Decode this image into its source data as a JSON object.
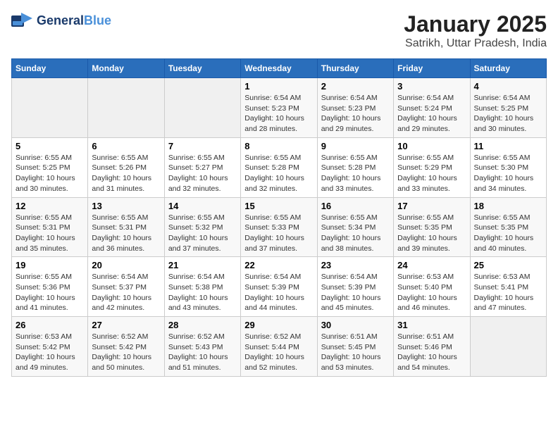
{
  "header": {
    "logo_line1": "General",
    "logo_line2": "Blue",
    "title": "January 2025",
    "subtitle": "Satrikh, Uttar Pradesh, India"
  },
  "weekdays": [
    "Sunday",
    "Monday",
    "Tuesday",
    "Wednesday",
    "Thursday",
    "Friday",
    "Saturday"
  ],
  "weeks": [
    [
      {
        "num": "",
        "info": ""
      },
      {
        "num": "",
        "info": ""
      },
      {
        "num": "",
        "info": ""
      },
      {
        "num": "1",
        "info": "Sunrise: 6:54 AM\nSunset: 5:23 PM\nDaylight: 10 hours\nand 28 minutes."
      },
      {
        "num": "2",
        "info": "Sunrise: 6:54 AM\nSunset: 5:23 PM\nDaylight: 10 hours\nand 29 minutes."
      },
      {
        "num": "3",
        "info": "Sunrise: 6:54 AM\nSunset: 5:24 PM\nDaylight: 10 hours\nand 29 minutes."
      },
      {
        "num": "4",
        "info": "Sunrise: 6:54 AM\nSunset: 5:25 PM\nDaylight: 10 hours\nand 30 minutes."
      }
    ],
    [
      {
        "num": "5",
        "info": "Sunrise: 6:55 AM\nSunset: 5:25 PM\nDaylight: 10 hours\nand 30 minutes."
      },
      {
        "num": "6",
        "info": "Sunrise: 6:55 AM\nSunset: 5:26 PM\nDaylight: 10 hours\nand 31 minutes."
      },
      {
        "num": "7",
        "info": "Sunrise: 6:55 AM\nSunset: 5:27 PM\nDaylight: 10 hours\nand 32 minutes."
      },
      {
        "num": "8",
        "info": "Sunrise: 6:55 AM\nSunset: 5:28 PM\nDaylight: 10 hours\nand 32 minutes."
      },
      {
        "num": "9",
        "info": "Sunrise: 6:55 AM\nSunset: 5:28 PM\nDaylight: 10 hours\nand 33 minutes."
      },
      {
        "num": "10",
        "info": "Sunrise: 6:55 AM\nSunset: 5:29 PM\nDaylight: 10 hours\nand 33 minutes."
      },
      {
        "num": "11",
        "info": "Sunrise: 6:55 AM\nSunset: 5:30 PM\nDaylight: 10 hours\nand 34 minutes."
      }
    ],
    [
      {
        "num": "12",
        "info": "Sunrise: 6:55 AM\nSunset: 5:31 PM\nDaylight: 10 hours\nand 35 minutes."
      },
      {
        "num": "13",
        "info": "Sunrise: 6:55 AM\nSunset: 5:31 PM\nDaylight: 10 hours\nand 36 minutes."
      },
      {
        "num": "14",
        "info": "Sunrise: 6:55 AM\nSunset: 5:32 PM\nDaylight: 10 hours\nand 37 minutes."
      },
      {
        "num": "15",
        "info": "Sunrise: 6:55 AM\nSunset: 5:33 PM\nDaylight: 10 hours\nand 37 minutes."
      },
      {
        "num": "16",
        "info": "Sunrise: 6:55 AM\nSunset: 5:34 PM\nDaylight: 10 hours\nand 38 minutes."
      },
      {
        "num": "17",
        "info": "Sunrise: 6:55 AM\nSunset: 5:35 PM\nDaylight: 10 hours\nand 39 minutes."
      },
      {
        "num": "18",
        "info": "Sunrise: 6:55 AM\nSunset: 5:35 PM\nDaylight: 10 hours\nand 40 minutes."
      }
    ],
    [
      {
        "num": "19",
        "info": "Sunrise: 6:55 AM\nSunset: 5:36 PM\nDaylight: 10 hours\nand 41 minutes."
      },
      {
        "num": "20",
        "info": "Sunrise: 6:54 AM\nSunset: 5:37 PM\nDaylight: 10 hours\nand 42 minutes."
      },
      {
        "num": "21",
        "info": "Sunrise: 6:54 AM\nSunset: 5:38 PM\nDaylight: 10 hours\nand 43 minutes."
      },
      {
        "num": "22",
        "info": "Sunrise: 6:54 AM\nSunset: 5:39 PM\nDaylight: 10 hours\nand 44 minutes."
      },
      {
        "num": "23",
        "info": "Sunrise: 6:54 AM\nSunset: 5:39 PM\nDaylight: 10 hours\nand 45 minutes."
      },
      {
        "num": "24",
        "info": "Sunrise: 6:53 AM\nSunset: 5:40 PM\nDaylight: 10 hours\nand 46 minutes."
      },
      {
        "num": "25",
        "info": "Sunrise: 6:53 AM\nSunset: 5:41 PM\nDaylight: 10 hours\nand 47 minutes."
      }
    ],
    [
      {
        "num": "26",
        "info": "Sunrise: 6:53 AM\nSunset: 5:42 PM\nDaylight: 10 hours\nand 49 minutes."
      },
      {
        "num": "27",
        "info": "Sunrise: 6:52 AM\nSunset: 5:42 PM\nDaylight: 10 hours\nand 50 minutes."
      },
      {
        "num": "28",
        "info": "Sunrise: 6:52 AM\nSunset: 5:43 PM\nDaylight: 10 hours\nand 51 minutes."
      },
      {
        "num": "29",
        "info": "Sunrise: 6:52 AM\nSunset: 5:44 PM\nDaylight: 10 hours\nand 52 minutes."
      },
      {
        "num": "30",
        "info": "Sunrise: 6:51 AM\nSunset: 5:45 PM\nDaylight: 10 hours\nand 53 minutes."
      },
      {
        "num": "31",
        "info": "Sunrise: 6:51 AM\nSunset: 5:46 PM\nDaylight: 10 hours\nand 54 minutes."
      },
      {
        "num": "",
        "info": ""
      }
    ]
  ]
}
